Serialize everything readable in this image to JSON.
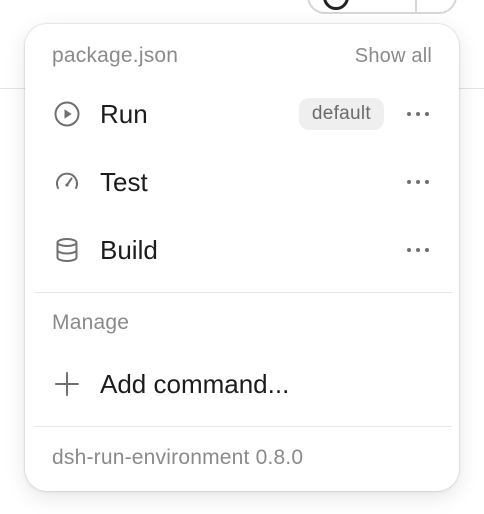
{
  "colors": {
    "text_primary": "#1c1c1c",
    "text_muted": "#8a8a8a",
    "badge_bg": "#efefef",
    "divider": "#e6e6e6"
  },
  "popover": {
    "header": {
      "title": "package.json",
      "show_all_label": "Show all"
    },
    "commands": [
      {
        "label": "Run",
        "icon": "play-circle-icon",
        "badge": "default",
        "more_icon": "more-horizontal-icon"
      },
      {
        "label": "Test",
        "icon": "gauge-icon",
        "more_icon": "more-horizontal-icon"
      },
      {
        "label": "Build",
        "icon": "database-icon",
        "more_icon": "more-horizontal-icon"
      }
    ],
    "manage": {
      "section_label": "Manage",
      "add_command_label": "Add command...",
      "add_icon": "plus-icon"
    },
    "footer": {
      "version_text": "dsh-run-environment 0.8.0"
    }
  }
}
